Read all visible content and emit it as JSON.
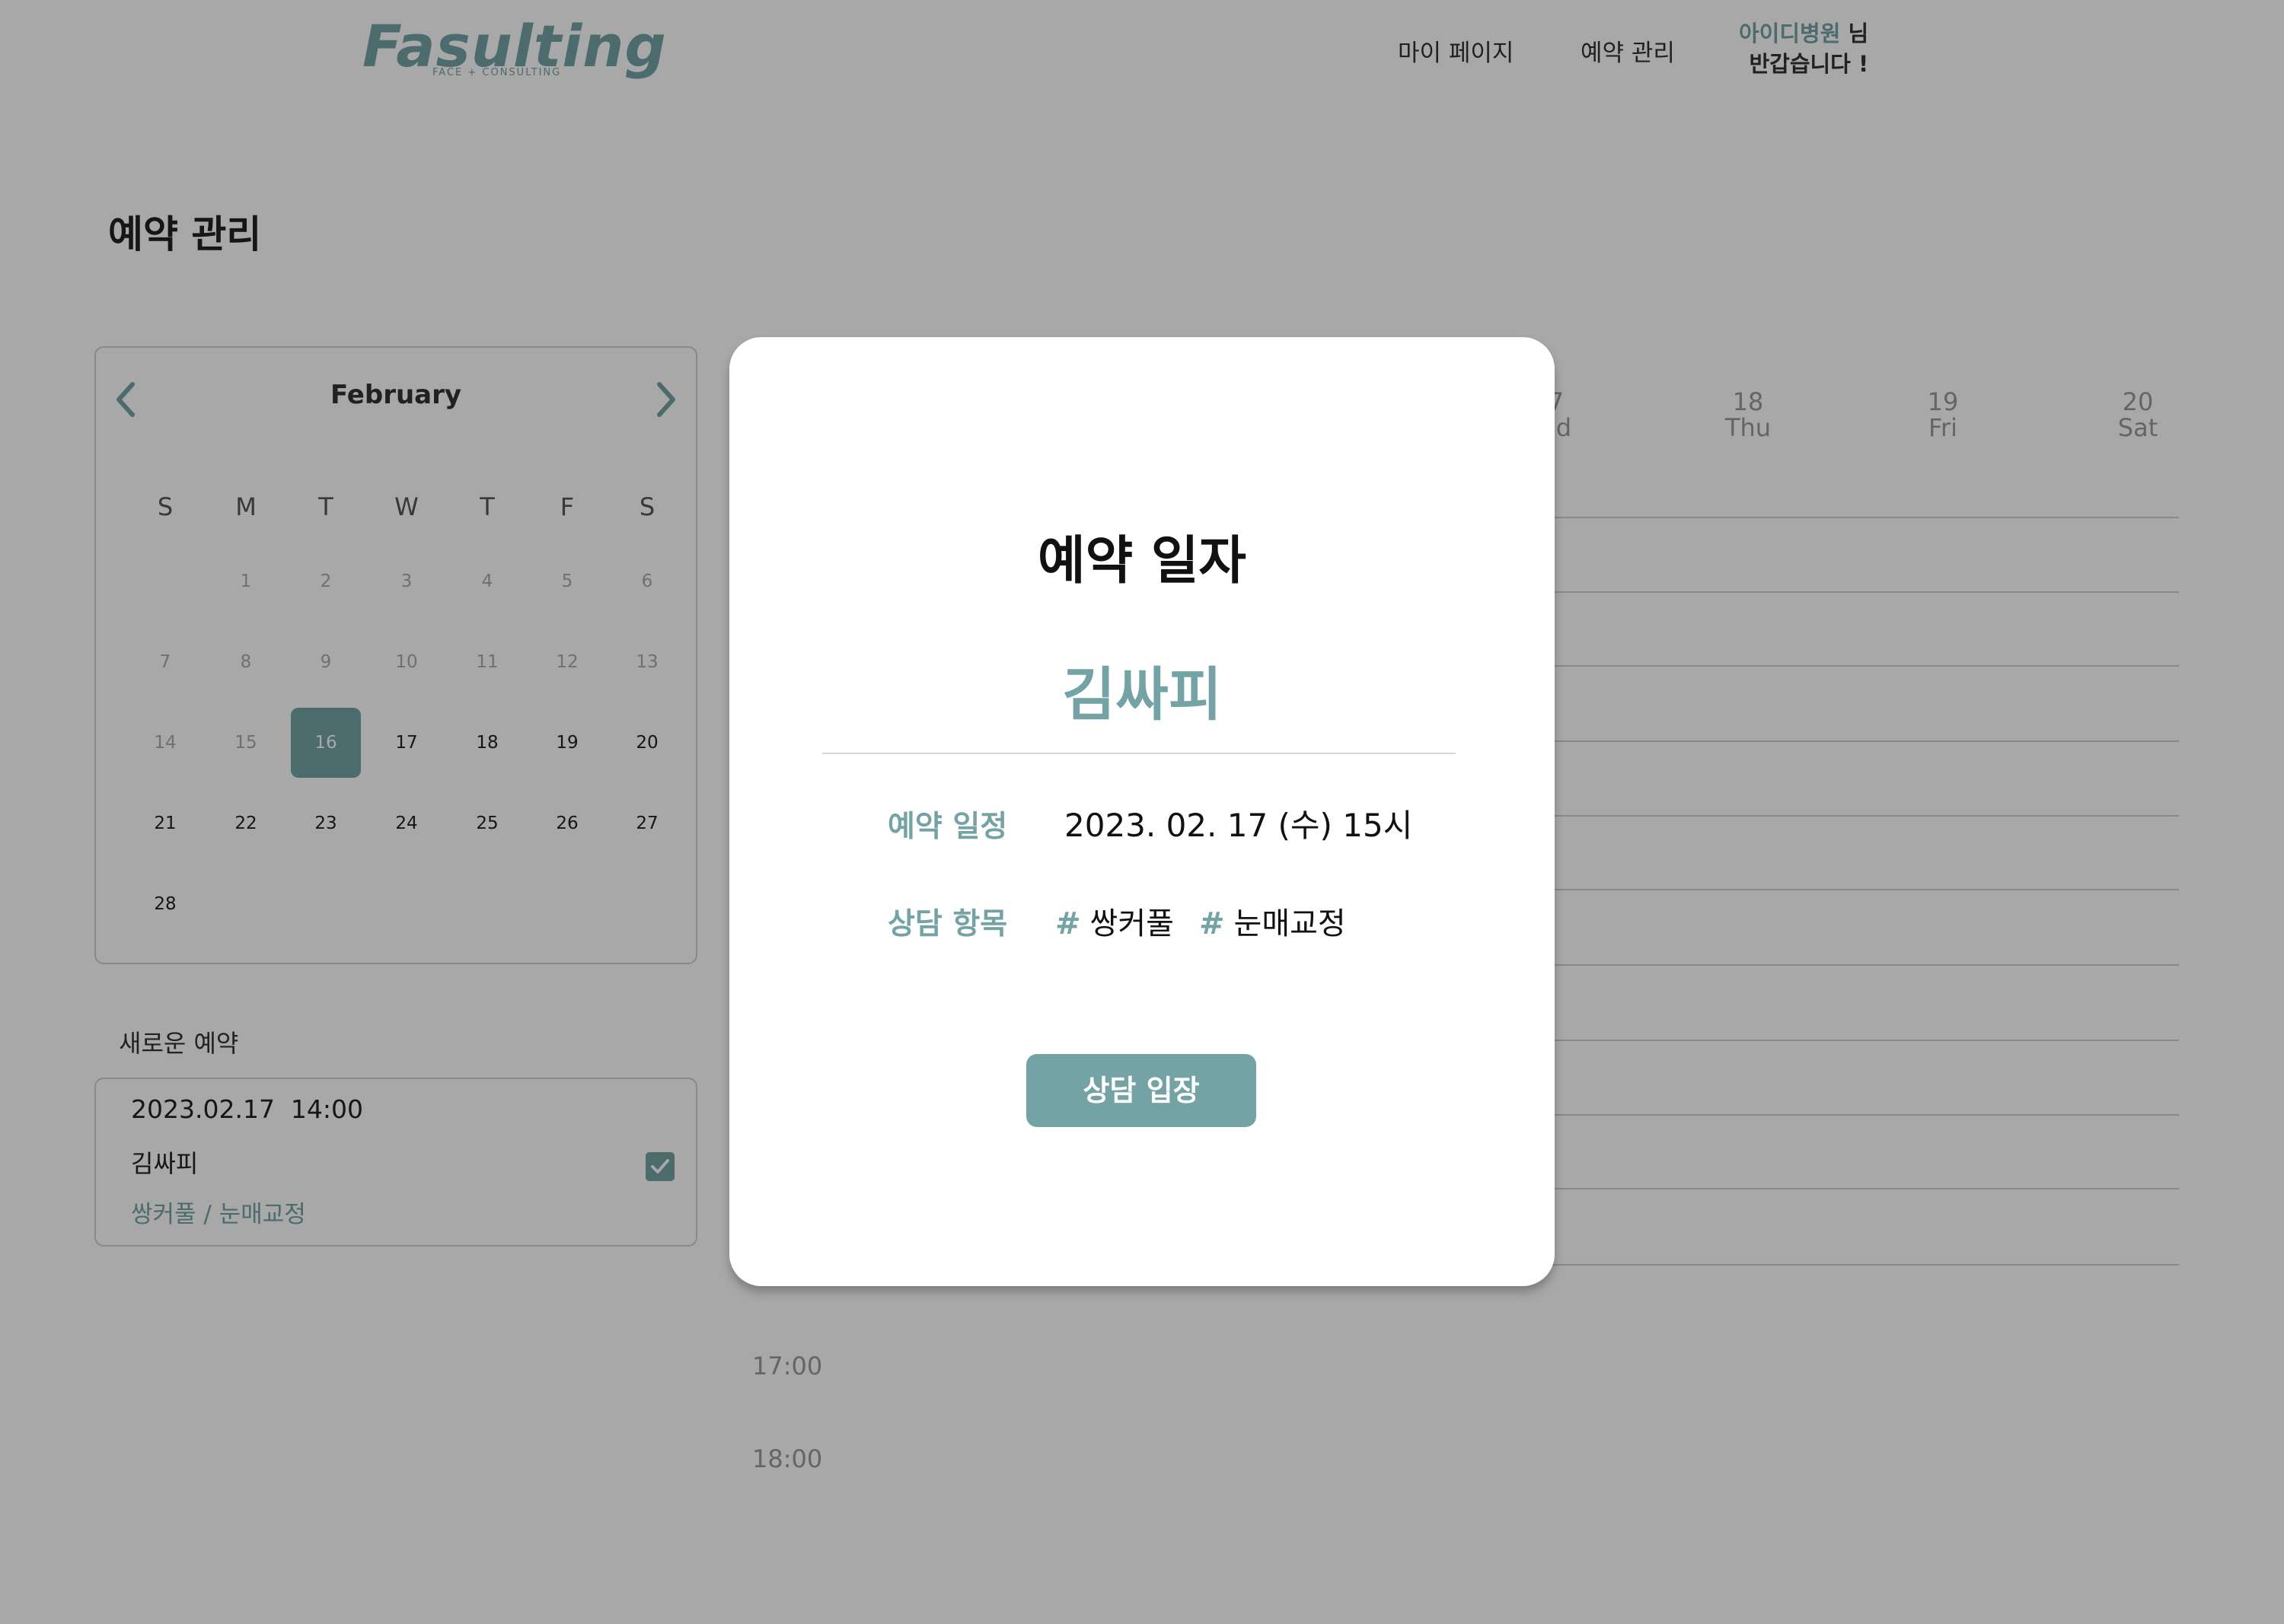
{
  "header": {
    "logo_text": "Fasulting",
    "logo_subtext": "FACE + CONSULTING",
    "nav": [
      "마이 페이지",
      "예약 관리"
    ],
    "user_name": "아이디병원",
    "user_suffix": " 님",
    "greeting": "반갑습니다 !"
  },
  "page_title": "예약 관리",
  "calendar": {
    "month": "February",
    "weekdays": [
      "S",
      "M",
      "T",
      "W",
      "T",
      "F",
      "S"
    ],
    "selected_day": 16,
    "weeks": [
      [
        "",
        "1",
        "2",
        "3",
        "4",
        "5",
        "6"
      ],
      [
        "7",
        "8",
        "9",
        "10",
        "11",
        "12",
        "13"
      ],
      [
        "14",
        "15",
        "16",
        "17",
        "18",
        "19",
        "20"
      ],
      [
        "21",
        "22",
        "23",
        "24",
        "25",
        "26",
        "27"
      ],
      [
        "28",
        "",
        "",
        "",
        "",
        "",
        ""
      ]
    ]
  },
  "new_reservation": {
    "title": "새로운 예약",
    "datetime": "2023.02.17  14:00",
    "name": "김싸피",
    "topics": "쌍커풀 / 눈매교정",
    "checked": true
  },
  "week_view": {
    "days": [
      {
        "num": "7",
        "dow": "ed"
      },
      {
        "num": "18",
        "dow": "Thu"
      },
      {
        "num": "19",
        "dow": "Fri"
      },
      {
        "num": "20",
        "dow": "Sat"
      }
    ],
    "times": [
      "17:00",
      "18:00"
    ]
  },
  "modal": {
    "title": "예약 일자",
    "name": "김싸피",
    "schedule_label": "예약 일정",
    "schedule_value": "2023. 02. 17 (수) 15시",
    "topic_label": "상담 항목",
    "tags": [
      "쌍커풀",
      "눈매교정"
    ],
    "hash": "#",
    "enter_button": "상담 입장"
  },
  "colors": {
    "accent": "#74A3A5",
    "overlay": "rgba(0,0,0,0.34)"
  }
}
